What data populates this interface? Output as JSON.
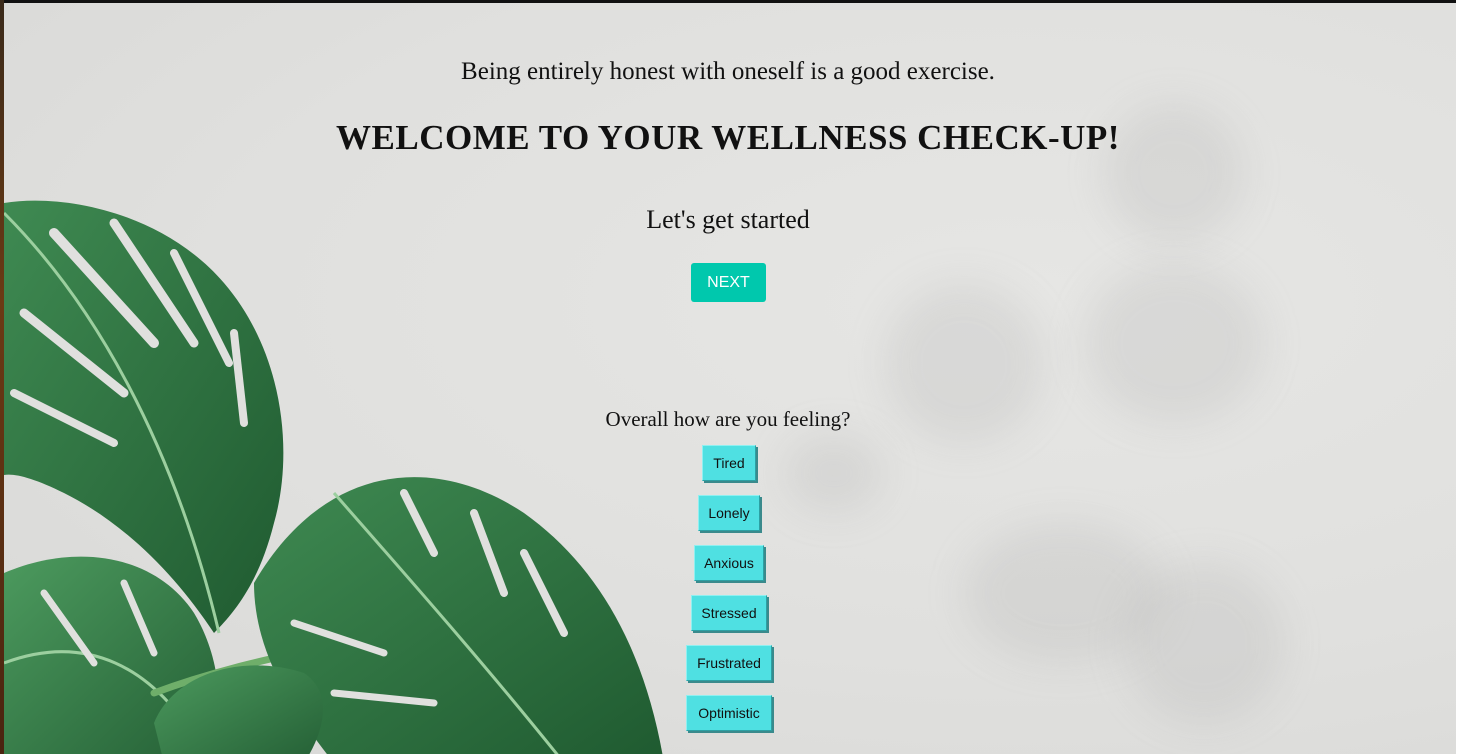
{
  "intro": {
    "subtitle": "Being entirely honest with oneself is a good exercise.",
    "title": "WELCOME TO YOUR WELLNESS CHECK-UP!",
    "started": "Let's get started",
    "next_label": "NEXT"
  },
  "feelings": {
    "question": "Overall how are you feeling?",
    "options": [
      "Tired",
      "Lonely",
      "Anxious",
      "Stressed",
      "Frustrated",
      "Optimistic"
    ]
  },
  "colors": {
    "next_button": "#00c8ad",
    "feeling_button": "#4fe0e2",
    "background": "#e0e0de",
    "leaf": "#2f6b3e"
  },
  "icons": {
    "background_image": "monstera-leaf-icon"
  }
}
